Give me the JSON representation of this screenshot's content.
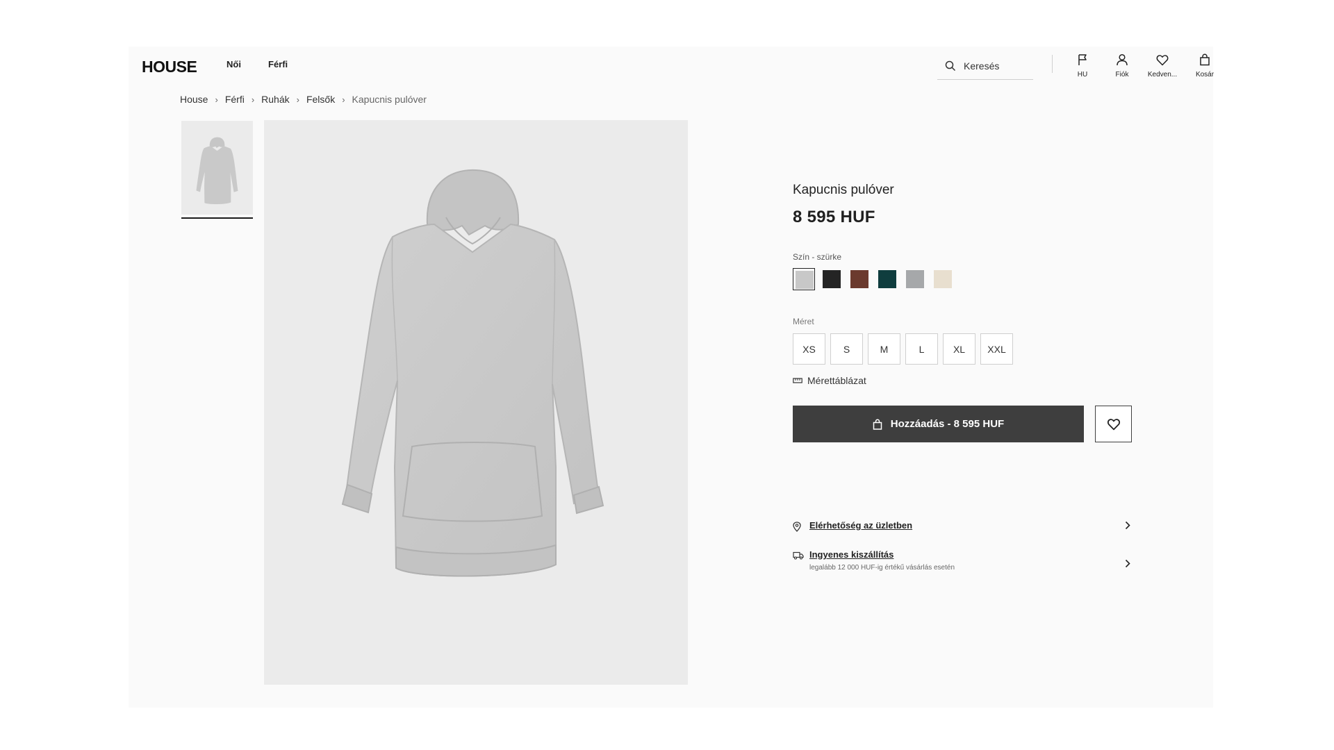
{
  "header": {
    "logo": "HOUSE",
    "nav": [
      "Női",
      "Férfi"
    ],
    "search_placeholder": "Keresés",
    "icons": [
      {
        "label": "HU",
        "icon": "flag-icon"
      },
      {
        "label": "Fiók",
        "icon": "user-icon"
      },
      {
        "label": "Kedven...",
        "icon": "heart-icon"
      },
      {
        "label": "Kosár",
        "icon": "bag-icon"
      }
    ]
  },
  "breadcrumb": [
    "House",
    "Férfi",
    "Ruhák",
    "Felsők",
    "Kapucnis pulóver"
  ],
  "product": {
    "title": "Kapucnis pulóver",
    "price": "8 595 HUF",
    "color_label": "Szín - szürke",
    "colors": [
      "#c8c8c8",
      "#242424",
      "#6b3a2e",
      "#0f3d3e",
      "#a6a8aa",
      "#e8dfcf"
    ],
    "selected_color_index": 0,
    "size_label": "Méret",
    "sizes": [
      "XS",
      "S",
      "M",
      "L",
      "XL",
      "XXL"
    ],
    "size_chart": "Mérettáblázat",
    "add_button": "Hozzáadás - 8 595 HUF",
    "store_availability": "Elérhetőség az üzletben",
    "free_shipping": "Ingyenes kiszállítás",
    "free_shipping_note": "legalább 12 000 HUF-ig értékű vásárlás esetén"
  }
}
